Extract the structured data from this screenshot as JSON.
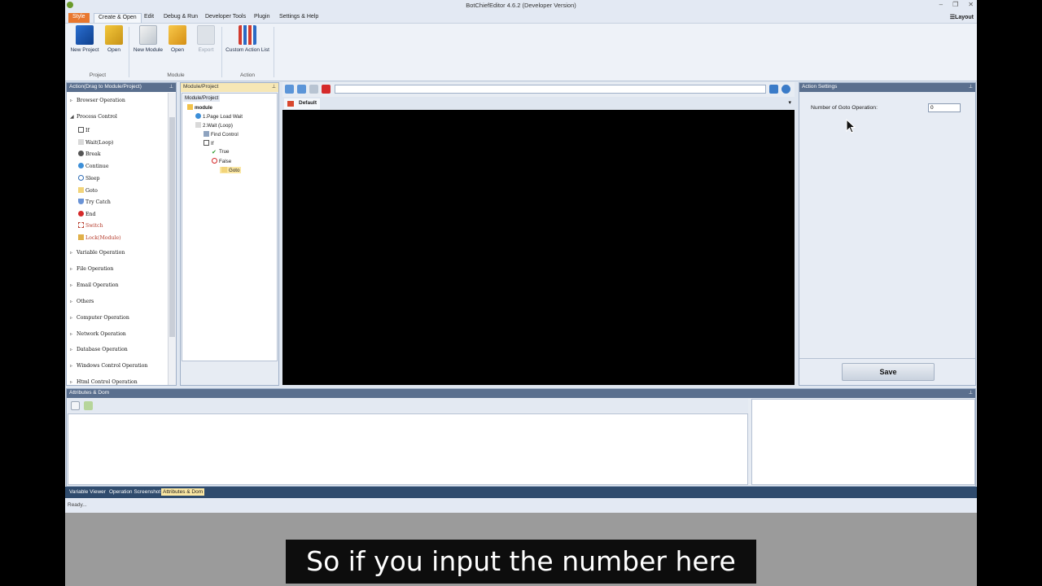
{
  "window": {
    "title": "BotChiefEditor 4.6.2 (Developer Version)",
    "win_buttons": [
      "–",
      "❐",
      "✕"
    ]
  },
  "menu": {
    "items": [
      "Style",
      "Create & Open",
      "Edit",
      "Debug & Run",
      "Developer Tools",
      "Plugin",
      "Settings & Help"
    ],
    "layout": "☰Layout"
  },
  "ribbon": {
    "buttons": [
      "New Project",
      "Open",
      "New Module",
      "Open",
      "Export",
      "Custom Action List"
    ],
    "groups": [
      "Project",
      "Module",
      "Action"
    ]
  },
  "action_panel": {
    "title": "Action(Drag to Module/Project)",
    "categories_top": [
      "Browser Operation",
      "Process Control"
    ],
    "process_items": [
      "If",
      "Wait(Loop)",
      "Break",
      "Continue",
      "Sleep",
      "Goto",
      "Try Catch",
      "End",
      "Switch",
      "Lock(Module)"
    ],
    "categories_bottom": [
      "Variable Operation",
      "File Operation",
      "Email Operation",
      "Others",
      "Computer Operation",
      "Network Operation",
      "Database Operation",
      "Windows Control Operation",
      "Html Control Operation"
    ]
  },
  "module_panel": {
    "title": "Module/Project",
    "tab": "Module/Project",
    "tree": [
      "module",
      "1.Page Load Wait",
      "2.Wait (Loop)",
      "Find Control",
      "If",
      "True",
      "False",
      "Goto"
    ]
  },
  "editor": {
    "tab": "Default"
  },
  "settings": {
    "title": "Action Settings",
    "field_label": "Number of Goto Operation:",
    "field_value": "0",
    "save": "Save"
  },
  "attributes": {
    "title": "Attributes & Dom"
  },
  "bottom_tabs": [
    "Variable Viewer",
    "Operation Screenshot",
    "Attributes & Dom"
  ],
  "status": "Ready...",
  "caption": "So if you input the number here",
  "colors": {
    "style_tab": "#e8772e",
    "panel_header": "#5a6f8e",
    "bottom_tabs": "#2f4b6d",
    "active_tab": "#fbe7a3"
  }
}
